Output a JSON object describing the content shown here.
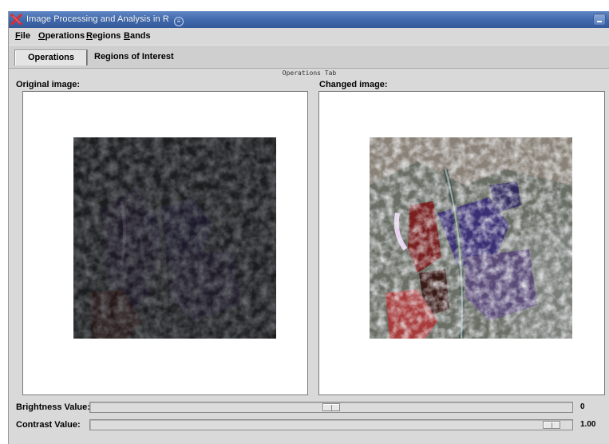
{
  "window": {
    "title": "Image Processing and Analysis in R",
    "shade_glyph": "≡",
    "accent_color": "#3f68ab"
  },
  "menu": {
    "items": [
      {
        "mnemonic": "F",
        "rest": "ile"
      },
      {
        "mnemonic": "O",
        "rest": "perations"
      },
      {
        "mnemonic": "R",
        "rest": "egions"
      },
      {
        "mnemonic": "B",
        "rest": "ands"
      }
    ]
  },
  "tabs": [
    {
      "label": "Operations",
      "active": true
    },
    {
      "label": "Regions of Interest",
      "active": false
    }
  ],
  "operations_tab": {
    "group_label": "Operations Tab",
    "original_label": "Original image:",
    "changed_label": "Changed image:"
  },
  "controls": {
    "brightness": {
      "label": "Brightness Value:",
      "value_text": "0",
      "position": 0.5
    },
    "contrast": {
      "label": "Contrast Value:",
      "value_text": "1.00",
      "position": 0.975
    }
  },
  "icons": {
    "app": "x-logo-icon",
    "shade": "shade-icon",
    "minimize": "minimize-icon"
  }
}
